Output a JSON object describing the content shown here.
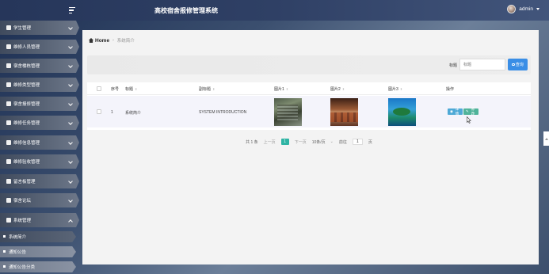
{
  "header": {
    "title": "高校宿舍报修管理系统",
    "username": "admin"
  },
  "sidebar": {
    "items": [
      {
        "label": "学生管理",
        "icon": "shield-icon"
      },
      {
        "label": "维修人员管理",
        "icon": "grid-icon"
      },
      {
        "label": "宿舍楼栋管理",
        "icon": "grid-icon"
      },
      {
        "label": "维修类型管理",
        "icon": "grid-icon"
      },
      {
        "label": "宿舍报修管理",
        "icon": "grid-icon"
      },
      {
        "label": "维修任务管理",
        "icon": "monitor-icon"
      },
      {
        "label": "维修信息管理",
        "icon": "grid-icon"
      },
      {
        "label": "维修验收管理",
        "icon": "list-icon"
      },
      {
        "label": "留言板管理",
        "icon": "chat-icon"
      },
      {
        "label": "宿舍论坛",
        "icon": "briefcase-icon"
      },
      {
        "label": "系统管理",
        "icon": "settings-icon"
      }
    ],
    "subitems": [
      {
        "label": "系统简介"
      },
      {
        "label": "通知公告"
      },
      {
        "label": "通知公告分类"
      }
    ]
  },
  "breadcrumb": {
    "home": "Home",
    "current": "系统简介"
  },
  "search": {
    "label": "标题",
    "placeholder": "标题",
    "button": "查询"
  },
  "table": {
    "headers": [
      "序号",
      "标题",
      "副标题",
      "图片1",
      "图片2",
      "图片3",
      "操作"
    ],
    "rows": [
      {
        "index": "1",
        "title": "系统简介",
        "subtitle": "SYSTEM INTRODUCTION",
        "actions": [
          "详情",
          "修改"
        ]
      }
    ]
  },
  "pagination": {
    "total": "共 1 条",
    "prev": "上一页",
    "current": "1",
    "next": "下一页",
    "page_size": "10条/页",
    "goto_label": "前往",
    "goto_value": "1",
    "page_suffix": "页"
  }
}
